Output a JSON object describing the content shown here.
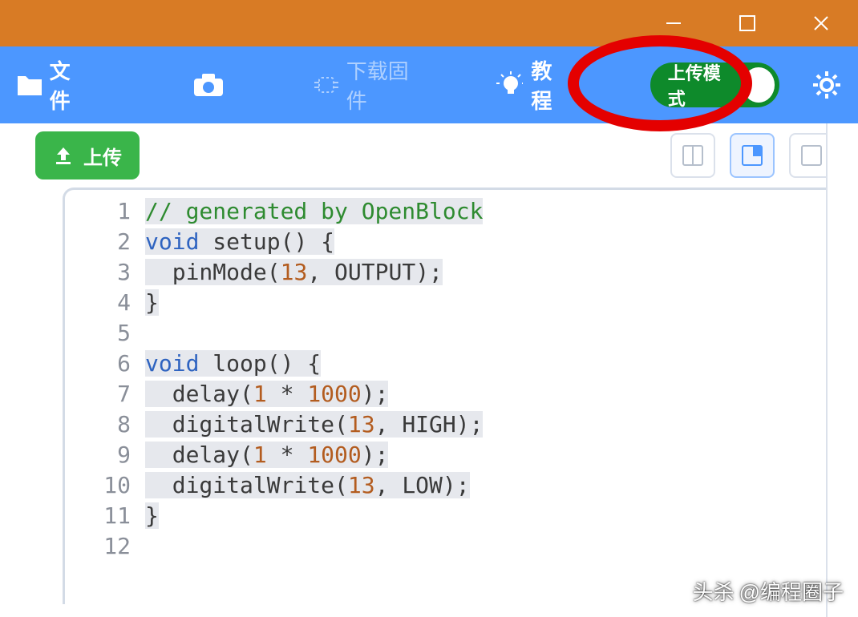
{
  "window": {
    "minimize": "—",
    "maximize": "□",
    "close": "✕"
  },
  "toolbar": {
    "file_label": "文件",
    "firmware_label": "下载固件",
    "tutorial_label": "教程",
    "mode_label": "上传模式"
  },
  "subbar": {
    "upload_label": "上传"
  },
  "code": {
    "lines_count": 12,
    "lines": [
      {
        "n": 1,
        "type": "comment",
        "text": "// generated by OpenBlock"
      },
      {
        "n": 2,
        "type": "decl",
        "kw": "void",
        "fn": "setup",
        "tail": "() {"
      },
      {
        "n": 3,
        "type": "call",
        "indent": "  ",
        "fn": "pinMode",
        "args": [
          {
            "t": "num",
            "v": "13"
          },
          {
            "t": "plain",
            "v": ", "
          },
          {
            "t": "con",
            "v": "OUTPUT"
          }
        ],
        "end": ");"
      },
      {
        "n": 4,
        "type": "plain",
        "text": "}"
      },
      {
        "n": 5,
        "type": "blank"
      },
      {
        "n": 6,
        "type": "decl",
        "kw": "void",
        "fn": "loop",
        "tail": "() {"
      },
      {
        "n": 7,
        "type": "call",
        "indent": "  ",
        "fn": "delay",
        "args": [
          {
            "t": "num",
            "v": "1"
          },
          {
            "t": "plain",
            "v": " * "
          },
          {
            "t": "num",
            "v": "1000"
          }
        ],
        "end": ");"
      },
      {
        "n": 8,
        "type": "call",
        "indent": "  ",
        "fn": "digitalWrite",
        "args": [
          {
            "t": "num",
            "v": "13"
          },
          {
            "t": "plain",
            "v": ", "
          },
          {
            "t": "con",
            "v": "HIGH"
          }
        ],
        "end": ");"
      },
      {
        "n": 9,
        "type": "call",
        "indent": "  ",
        "fn": "delay",
        "args": [
          {
            "t": "num",
            "v": "1"
          },
          {
            "t": "plain",
            "v": " * "
          },
          {
            "t": "num",
            "v": "1000"
          }
        ],
        "end": ");"
      },
      {
        "n": 10,
        "type": "call",
        "indent": "  ",
        "fn": "digitalWrite",
        "args": [
          {
            "t": "num",
            "v": "13"
          },
          {
            "t": "plain",
            "v": ", "
          },
          {
            "t": "con",
            "v": "LOW"
          }
        ],
        "end": ");"
      },
      {
        "n": 11,
        "type": "plain",
        "text": "}"
      },
      {
        "n": 12,
        "type": "blank"
      }
    ]
  },
  "watermark": {
    "prefix": "头杀",
    "handle": "@编程圈子"
  }
}
